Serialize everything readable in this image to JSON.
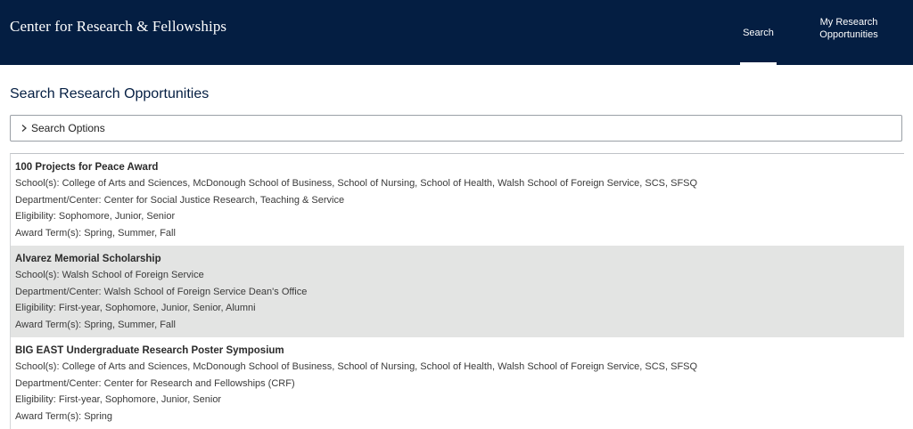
{
  "header": {
    "brand": "Center for Research & Fellowships",
    "nav": {
      "search": "Search",
      "my_research_line1": "My Research",
      "my_research_line2": "Opportunities"
    }
  },
  "page": {
    "title": "Search Research Opportunities",
    "search_options_label": "Search Options"
  },
  "results": [
    {
      "title": "100 Projects for Peace Award",
      "schools": "School(s): College of Arts and Sciences, McDonough School of Business, School of Nursing, School of Health, Walsh School of Foreign Service, SCS, SFSQ",
      "department": "Department/Center: Center for Social Justice Research, Teaching & Service",
      "eligibility": "Eligibility: Sophomore, Junior, Senior",
      "terms": "Award Term(s): Spring, Summer, Fall"
    },
    {
      "title": "Alvarez Memorial Scholarship",
      "schools": "School(s): Walsh School of Foreign Service",
      "department": "Department/Center: Walsh School of Foreign Service Dean's Office",
      "eligibility": "Eligibility: First-year, Sophomore, Junior, Senior, Alumni",
      "terms": "Award Term(s): Spring, Summer, Fall"
    },
    {
      "title": "BIG EAST Undergraduate Research Poster Symposium",
      "schools": "School(s): College of Arts and Sciences, McDonough School of Business, School of Nursing, School of Health, Walsh School of Foreign Service, SCS, SFSQ",
      "department": "Department/Center: Center for Research and Fellowships (CRF)",
      "eligibility": "Eligibility: First-year, Sophomore, Junior, Senior",
      "terms": "Award Term(s): Spring"
    }
  ],
  "colors": {
    "header_bg": "#041e42",
    "alt_row_bg": "#e3e4e3",
    "title_color": "#041e42"
  },
  "icons": {
    "search_options": "chevron-right-icon"
  }
}
